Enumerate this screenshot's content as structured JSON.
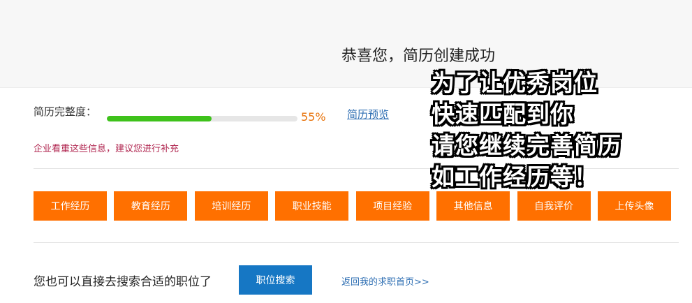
{
  "header": {
    "title": "恭喜您，简历创建成功"
  },
  "resume_completeness": {
    "label": "简历完整度：",
    "percent": 55,
    "percent_text": "55%",
    "preview_link": "简历预览",
    "hint": "企业看重这些信息，建议您进行补充",
    "fill_color": "#3ec21b"
  },
  "sections": [
    {
      "label": "工作经历"
    },
    {
      "label": "教育经历"
    },
    {
      "label": "培训经历"
    },
    {
      "label": "职业技能"
    },
    {
      "label": "项目经验"
    },
    {
      "label": "其他信息"
    },
    {
      "label": "自我评价"
    },
    {
      "label": "上传头像"
    }
  ],
  "search": {
    "prompt": "您也可以直接去搜索合适的职位了",
    "button_label": "职位搜索",
    "home_link": "返回我的求职首页>>"
  },
  "overlay_caption": {
    "lines": [
      "为了让优秀岗位",
      "快速匹配到你",
      "请您继续完善简历",
      "如工作经历等！"
    ]
  },
  "colors": {
    "section_button": "#ff7000",
    "search_button": "#1677c4",
    "link": "#2f6fb3",
    "hint": "#b0254f",
    "percent": "#e8730b"
  }
}
